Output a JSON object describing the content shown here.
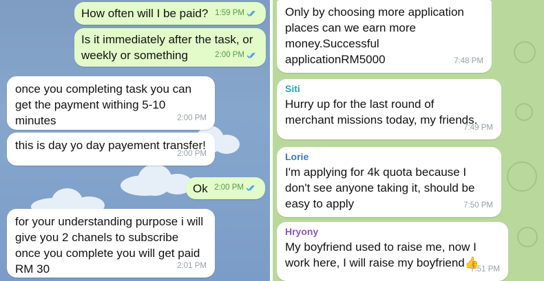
{
  "left_chat": {
    "messages": [
      {
        "text": "How often will I be paid?",
        "time": "1:59 PM"
      },
      {
        "text": "Is it immediately after the task, or\nweekly or something",
        "time": "2:00 PM"
      },
      {
        "text": "once you completing task you can\nget the payment withing 5-10\nminutes",
        "time": "2:00 PM"
      },
      {
        "text": "this is day yo day payement transfer!",
        "time": "2:00 PM"
      },
      {
        "text": "Ok",
        "time": "2:00 PM"
      },
      {
        "text": "for your understanding purpose i will\ngive you 2 chanels to subscribe\nonce you complete you will get paid\nRM 30",
        "time": "2:01 PM"
      }
    ]
  },
  "right_chat": {
    "messages": [
      {
        "sender": "",
        "text": "Only by choosing more application\nplaces can we earn more\nmoney.Successful\napplicationRM5000",
        "time": "7:48 PM"
      },
      {
        "sender": "Siti",
        "text": "Hurry up for the last round of\nmerchant missions today, my friends.",
        "time": "7:49 PM"
      },
      {
        "sender": "Lorie",
        "text": "I'm applying for 4k quota because I\ndon't see anyone taking it, should be\neasy to apply",
        "time": "7:50 PM"
      },
      {
        "sender": "Hryony",
        "text": "My boyfriend used to raise me, now I\nwork here, I will raise my boyfriend👍",
        "time": "7:51 PM"
      }
    ]
  },
  "colors": {
    "outgoing_bubble": "#e2fbc9",
    "incoming_bubble": "#ffffff",
    "read_check": "#4fa3e0",
    "sender_siti": "#2aa3b8",
    "sender_lorie": "#3a78c4",
    "sender_hryony": "#8a55c8"
  }
}
